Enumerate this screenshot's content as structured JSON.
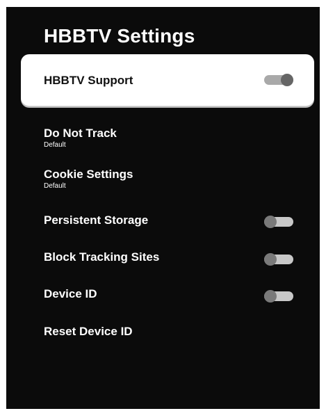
{
  "page_title": "HBBTV Settings",
  "hbbtv_support": {
    "label": "HBBTV Support",
    "enabled": true
  },
  "do_not_track": {
    "label": "Do Not Track",
    "value": "Default"
  },
  "cookie_settings": {
    "label": "Cookie Settings",
    "value": "Default"
  },
  "persistent_storage": {
    "label": "Persistent Storage",
    "enabled": false
  },
  "block_tracking_sites": {
    "label": "Block Tracking Sites",
    "enabled": false
  },
  "device_id": {
    "label": "Device ID",
    "enabled": false
  },
  "reset_device_id": {
    "label": "Reset Device ID"
  },
  "colors": {
    "background": "#0b0b0b",
    "focus_card": "#ffffff",
    "text": "#ffffff",
    "focused_text": "#111111"
  }
}
